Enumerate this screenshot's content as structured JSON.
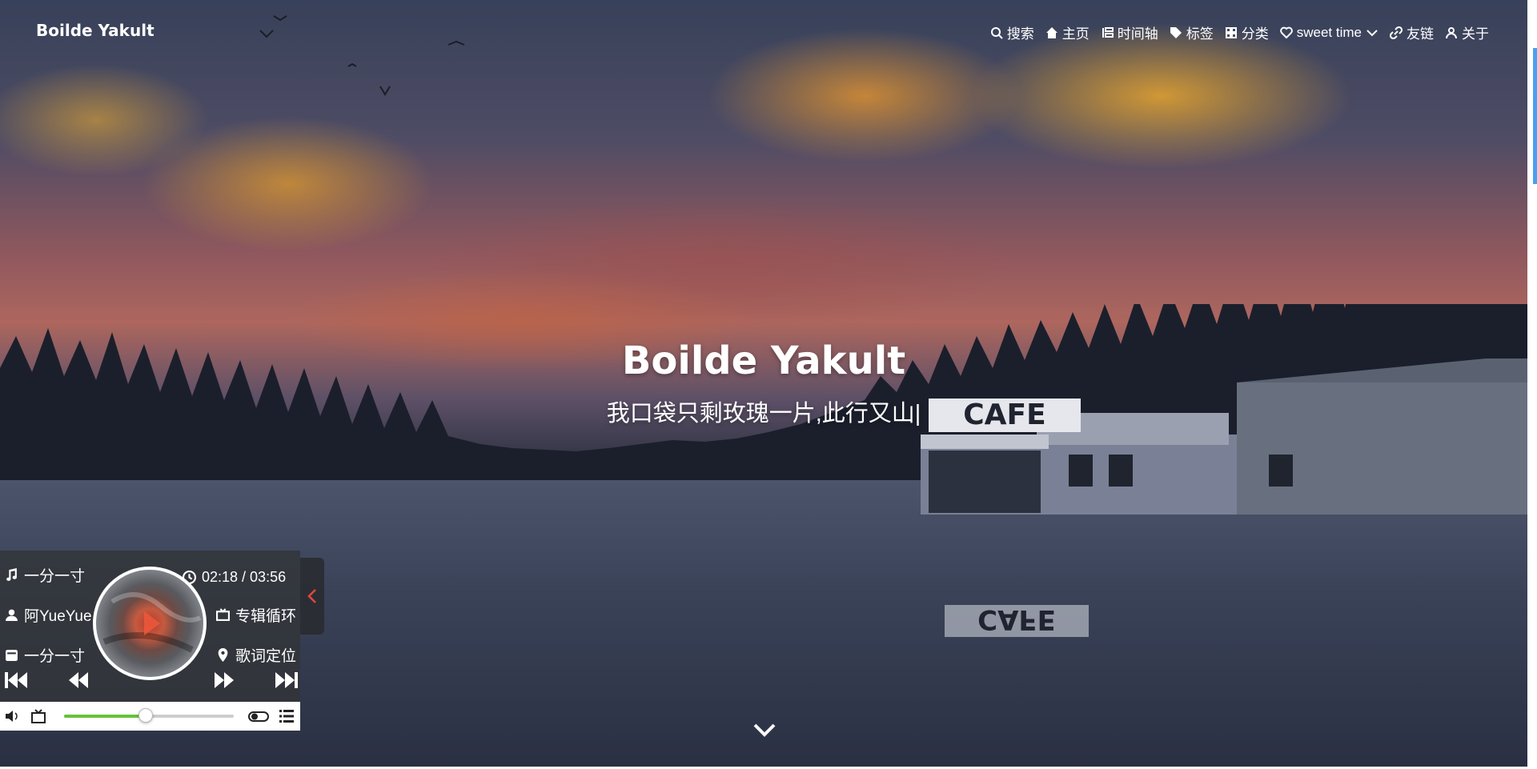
{
  "header": {
    "brand": "Boilde Yakult",
    "nav": [
      {
        "label": "搜索",
        "icon": "search-icon"
      },
      {
        "label": "主页",
        "icon": "home-icon"
      },
      {
        "label": "时间轴",
        "icon": "timeline-icon"
      },
      {
        "label": "标签",
        "icon": "tag-icon"
      },
      {
        "label": "分类",
        "icon": "grid-icon"
      },
      {
        "label": "sweet time",
        "icon": "heart-icon",
        "has_dropdown": true
      },
      {
        "label": "友链",
        "icon": "link-icon"
      },
      {
        "label": "关于",
        "icon": "user-icon"
      }
    ]
  },
  "hero": {
    "title": "Boilde Yakult",
    "subtitle": "我口袋只剩玫瑰一片,此行又山|",
    "sign_text": "CAFE",
    "reflection_text": "CAFE"
  },
  "player": {
    "song": "一分一寸",
    "artist": "阿YueYue",
    "album": "一分一寸",
    "time": "02:18 / 03:56",
    "current": "02:18",
    "duration": "03:56",
    "mode": "专辑循环",
    "lyrics": "歌词定位",
    "progress_fraction": 0.48,
    "progress_color": "#67c23a"
  },
  "colors": {
    "accent": "#49a0f0",
    "player_bg": "#323438"
  }
}
